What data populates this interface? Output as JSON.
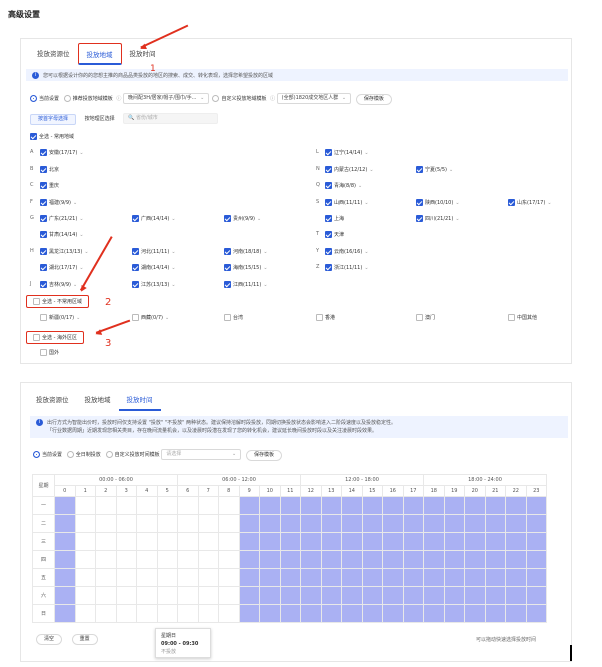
{
  "page_title": "高级设置",
  "tabs_top": [
    "投放资源位",
    "投放地域",
    "投放时间"
  ],
  "tabs_bottom": [
    "投放资源位",
    "投放地域",
    "投放时间"
  ],
  "region_tip": "您可以根据设计你的的您想主推的商品品类投放的地区的搜索、成交、转化表现，选择您希望投放的区域",
  "region_setting": {
    "current": "当前设置",
    "recommended": "推荐投放地域模板",
    "template_select": "晚间配3H/居家/帽子/围巾/手...",
    "custom": "自定义投放地域模板",
    "custom_select": "(全部)1820成交地区人群",
    "save": "保存模板"
  },
  "filter": {
    "by_letter": "按首字母选择",
    "by_area": "按地理区选择",
    "search_placeholder": "省份/城市"
  },
  "select_all_common": "全选 - 常用地域",
  "regions": {
    "A": "安徽(17/17)",
    "B": "北京",
    "C": "重庆",
    "F": "福建(9/9)",
    "G1": "广东(21/21)",
    "G2": "广西(14/14)",
    "G3": "贵州(9/9)",
    "G4": "甘肃(14/14)",
    "H1": "黑龙江(13/13)",
    "H2": "河北(11/11)",
    "H3": "河南(18/18)",
    "H4": "湖北(17/17)",
    "H5": "湖南(14/14)",
    "H6": "海南(15/15)",
    "J1": "吉林(9/9)",
    "J2": "江苏(13/13)",
    "J3": "江西(11/11)",
    "L": "辽宁(14/14)",
    "N1": "内蒙古(12/12)",
    "N2": "宁夏(5/5)",
    "Q": "青海(8/8)",
    "S1": "山西(11/11)",
    "S2": "陕西(10/10)",
    "S3": "山东(17/17)",
    "S4": "上海",
    "S5": "四川(21/21)",
    "T": "天津",
    "Y": "云南(16/16)",
    "Z": "浙江(11/11)"
  },
  "letters": [
    "A",
    "B",
    "C",
    "F",
    "G",
    "H",
    "J",
    "L",
    "N",
    "Q",
    "S",
    "T",
    "Y",
    "Z"
  ],
  "select_all_uncommon": "全选 - 不常用区域",
  "uncommon": [
    "新疆(0/17)",
    "西藏(0/7)",
    "台湾",
    "香港",
    "澳门",
    "中国其他"
  ],
  "select_all_overseas": "全选 - 海外区区",
  "overseas": [
    "国外"
  ],
  "annotations": [
    "1",
    "2",
    "3"
  ],
  "time_tip_1": "出行方式为智能出价时，投放时间仅支持设置 \"投放\" \"不投放\" 两种状态。建议保持溶解时段投放，同期切换投放状态会影响进入二阶段速度以及投放稳定性。",
  "time_tip_2": "「行业数据周期」近期发现您相关类目，存在晚间流量机会，以及凌晨时段潜在发现了您的转化机会，建议延长晚间投放时段以及关注凌晨时段效果。",
  "time_setting": {
    "current": "当前设置",
    "all_day": "全日制投放",
    "custom": "自定义投放时间模板",
    "select_placeholder": "请选择",
    "save": "保存模板"
  },
  "time_groups": [
    "00:00 - 06:00",
    "06:00 - 12:00",
    "12:00 - 18:00",
    "18:00 - 24:00"
  ],
  "hours": [
    "0",
    "1",
    "2",
    "3",
    "4",
    "5",
    "6",
    "7",
    "8",
    "9",
    "10",
    "11",
    "12",
    "13",
    "14",
    "15",
    "16",
    "17",
    "18",
    "19",
    "20",
    "21",
    "22",
    "23"
  ],
  "weekday_header": "星期",
  "weekdays": [
    "一",
    "二",
    "三",
    "四",
    "五",
    "六",
    "日"
  ],
  "schedule_on_from_hour": 9,
  "buttons": {
    "clear": "清空",
    "reset": "重置"
  },
  "tooltip": {
    "day": "星期日",
    "time": "09:00 - 09:30",
    "status": "不投放"
  },
  "hint_right": "可以拖动快速选择投放时间",
  "colors": {
    "accent": "#2a5bd7",
    "selected": "#aab1f3",
    "annotation": "#e0301e"
  }
}
